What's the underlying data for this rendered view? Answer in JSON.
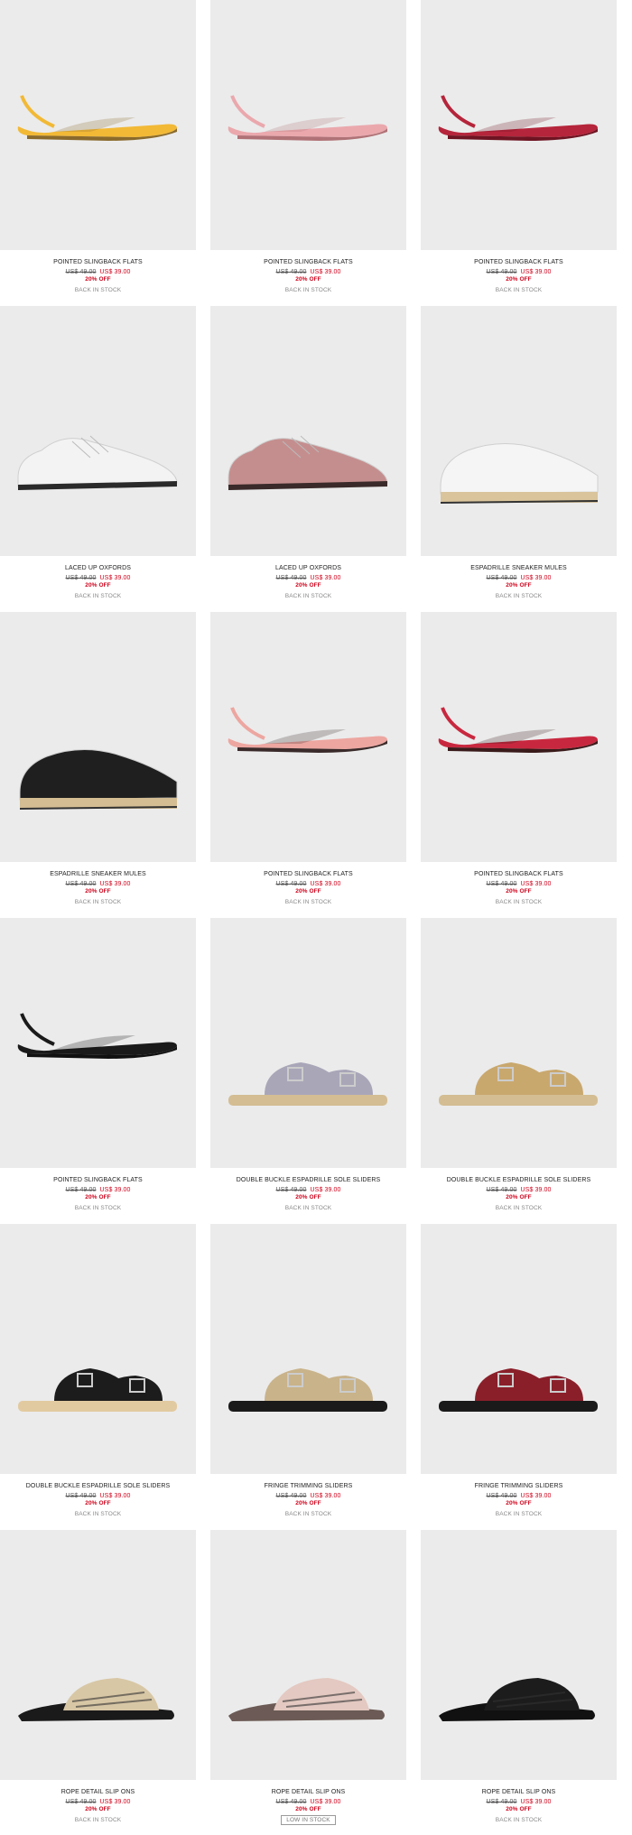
{
  "products": [
    {
      "name": "POINTED SLINGBACK FLATS",
      "old_price": "US$ 49.00",
      "new_price": "US$ 39.00",
      "discount": "20% OFF",
      "stock": "BACK IN STOCK",
      "image": "yellow pointed slingback flat",
      "colors": {
        "upper": "#f2b936",
        "sole": "#8a6a2c"
      }
    },
    {
      "name": "POINTED SLINGBACK FLATS",
      "old_price": "US$ 49.00",
      "new_price": "US$ 39.00",
      "discount": "20% OFF",
      "stock": "BACK IN STOCK",
      "image": "pink pointed slingback flat",
      "colors": {
        "upper": "#eaa8ad",
        "sole": "#b07276"
      }
    },
    {
      "name": "POINTED SLINGBACK FLATS",
      "old_price": "US$ 49.00",
      "new_price": "US$ 39.00",
      "discount": "20% OFF",
      "stock": "BACK IN STOCK",
      "image": "red pointed slingback flat",
      "colors": {
        "upper": "#b5253b",
        "sole": "#6e1422"
      }
    },
    {
      "name": "LACED UP OXFORDS",
      "old_price": "US$ 49.00",
      "new_price": "US$ 39.00",
      "discount": "20% OFF",
      "stock": "BACK IN STOCK",
      "image": "white laced up oxford",
      "colors": {
        "upper": "#f3f3f3",
        "sole": "#2a2a2a"
      }
    },
    {
      "name": "LACED UP OXFORDS",
      "old_price": "US$ 49.00",
      "new_price": "US$ 39.00",
      "discount": "20% OFF",
      "stock": "BACK IN STOCK",
      "image": "mauve laced up oxford",
      "colors": {
        "upper": "#c58e8e",
        "sole": "#3a2a2a"
      }
    },
    {
      "name": "ESPADRILLE SNEAKER MULES",
      "old_price": "US$ 49.00",
      "new_price": "US$ 39.00",
      "discount": "20% OFF",
      "stock": "BACK IN STOCK",
      "image": "white espadrille sneaker mule",
      "colors": {
        "upper": "#f5f5f5",
        "sole": "#d9c49c"
      }
    },
    {
      "name": "ESPADRILLE SNEAKER MULES",
      "old_price": "US$ 49.00",
      "new_price": "US$ 39.00",
      "discount": "20% OFF",
      "stock": "BACK IN STOCK",
      "image": "black espadrille sneaker mule",
      "colors": {
        "upper": "#1f1f1f",
        "sole": "#d4bd93"
      }
    },
    {
      "name": "POINTED SLINGBACK FLATS",
      "old_price": "US$ 49.00",
      "new_price": "US$ 39.00",
      "discount": "20% OFF",
      "stock": "BACK IN STOCK",
      "image": "pink slingback flat with strap",
      "colors": {
        "upper": "#eda6a0",
        "sole": "#3a2a2a"
      }
    },
    {
      "name": "POINTED SLINGBACK FLATS",
      "old_price": "US$ 49.00",
      "new_price": "US$ 39.00",
      "discount": "20% OFF",
      "stock": "BACK IN STOCK",
      "image": "red slingback flat with strap",
      "colors": {
        "upper": "#c8283f",
        "sole": "#3a1a1a"
      }
    },
    {
      "name": "POINTED SLINGBACK FLATS",
      "old_price": "US$ 49.00",
      "new_price": "US$ 39.00",
      "discount": "20% OFF",
      "stock": "BACK IN STOCK",
      "image": "black slingback flat with strap",
      "colors": {
        "upper": "#1a1a1a",
        "sole": "#111111"
      }
    },
    {
      "name": "DOUBLE BUCKLE ESPADRILLE SOLE SLIDERS",
      "old_price": "US$ 49.00",
      "new_price": "US$ 39.00",
      "discount": "20% OFF",
      "stock": "BACK IN STOCK",
      "image": "glitter double buckle slider",
      "colors": {
        "upper": "#a9a6b8",
        "sole": "#d4bd93"
      }
    },
    {
      "name": "DOUBLE BUCKLE ESPADRILLE SOLE SLIDERS",
      "old_price": "US$ 49.00",
      "new_price": "US$ 39.00",
      "discount": "20% OFF",
      "stock": "BACK IN STOCK",
      "image": "tan double buckle slider",
      "colors": {
        "upper": "#c9a86e",
        "sole": "#d4bd93"
      }
    },
    {
      "name": "DOUBLE BUCKLE ESPADRILLE SOLE SLIDERS",
      "old_price": "US$ 49.00",
      "new_price": "US$ 39.00",
      "discount": "20% OFF",
      "stock": "BACK IN STOCK",
      "image": "black double buckle slider",
      "colors": {
        "upper": "#1c1c1c",
        "sole": "#e2caa0"
      }
    },
    {
      "name": "FRINGE TRIMMING SLIDERS",
      "old_price": "US$ 49.00",
      "new_price": "US$ 39.00",
      "discount": "20% OFF",
      "stock": "BACK IN STOCK",
      "image": "woven fringe slider",
      "colors": {
        "upper": "#c9b38a",
        "sole": "#1a1a1a"
      }
    },
    {
      "name": "FRINGE TRIMMING SLIDERS",
      "old_price": "US$ 49.00",
      "new_price": "US$ 39.00",
      "discount": "20% OFF",
      "stock": "BACK IN STOCK",
      "image": "embellished fringe slider",
      "colors": {
        "upper": "#8a1f2a",
        "sole": "#1a1a1a"
      }
    },
    {
      "name": "ROPE DETAIL SLIP ONS",
      "old_price": "US$ 49.00",
      "new_price": "US$ 39.00",
      "discount": "20% OFF",
      "stock": "BACK IN STOCK",
      "image": "woven rope slip on",
      "colors": {
        "upper": "#d8c7a5",
        "sole": "#1a1a1a"
      }
    },
    {
      "name": "ROPE DETAIL SLIP ONS",
      "old_price": "US$ 49.00",
      "new_price": "US$ 39.00",
      "discount": "20% OFF",
      "stock": "LOW IN STOCK",
      "image": "blush rope slip on",
      "colors": {
        "upper": "#e3c9c1",
        "sole": "#6b5a55"
      }
    },
    {
      "name": "ROPE DETAIL SLIP ONS",
      "old_price": "US$ 49.00",
      "new_price": "US$ 39.00",
      "discount": "20% OFF",
      "stock": "BACK IN STOCK",
      "image": "black rope slip on",
      "colors": {
        "upper": "#1c1c1c",
        "sole": "#111111"
      }
    }
  ]
}
